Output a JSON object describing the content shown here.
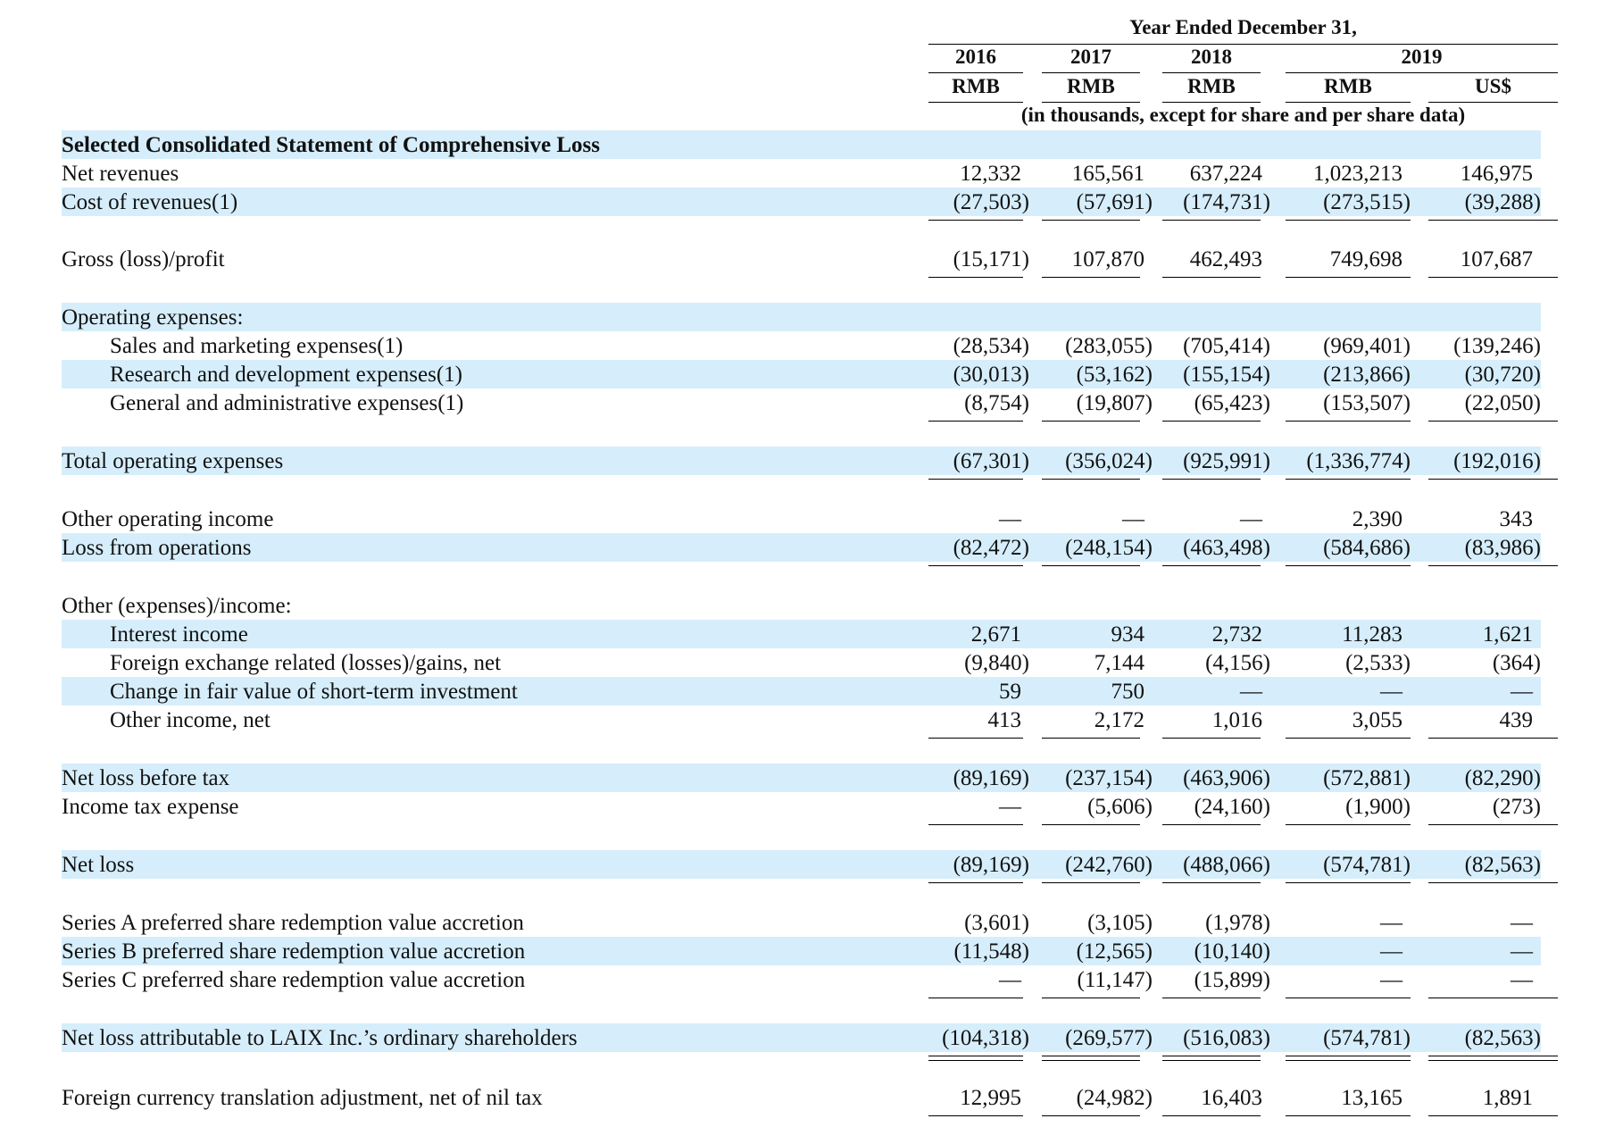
{
  "header": {
    "caption": "Year Ended December 31,",
    "years": [
      "2016",
      "2017",
      "2018",
      "2019"
    ],
    "currencies": [
      "RMB",
      "RMB",
      "RMB",
      "RMB",
      "US$"
    ],
    "note": "(in thousands, except for share and per share data)"
  },
  "colors": {
    "band": "#d6eefb",
    "text": "#111111"
  },
  "rows": [
    {
      "label": "Selected Consolidated Statement of Comprehensive Loss",
      "bold": true,
      "band": true,
      "values": []
    },
    {
      "label": "Net revenues",
      "values": [
        "12,332",
        "165,561",
        "637,224",
        "1,023,213",
        "146,975"
      ]
    },
    {
      "label": "Cost of revenues(1)",
      "band": true,
      "values": [
        "(27,503)",
        "(57,691)",
        "(174,731)",
        "(273,515)",
        "(39,288)"
      ],
      "underline": "single"
    },
    {
      "label": "Gross (loss)/profit",
      "values": [
        "(15,171)",
        "107,870",
        "462,493",
        "749,698",
        "107,687"
      ],
      "underline": "single"
    },
    {
      "label": "Operating expenses:",
      "band": true,
      "values": []
    },
    {
      "label": "Sales and marketing expenses(1)",
      "indent": true,
      "values": [
        "(28,534)",
        "(283,055)",
        "(705,414)",
        "(969,401)",
        "(139,246)"
      ]
    },
    {
      "label": "Research and development expenses(1)",
      "indent": true,
      "band": true,
      "values": [
        "(30,013)",
        "(53,162)",
        "(155,154)",
        "(213,866)",
        "(30,720)"
      ]
    },
    {
      "label": "General and administrative expenses(1)",
      "indent": true,
      "values": [
        "(8,754)",
        "(19,807)",
        "(65,423)",
        "(153,507)",
        "(22,050)"
      ],
      "underline": "single"
    },
    {
      "label": "Total operating expenses",
      "band": true,
      "values": [
        "(67,301)",
        "(356,024)",
        "(925,991)",
        "(1,336,774)",
        "(192,016)"
      ],
      "underline": "single"
    },
    {
      "label": "Other operating income",
      "values": [
        "—",
        "—",
        "—",
        "2,390",
        "343"
      ]
    },
    {
      "label": "Loss from operations",
      "band": true,
      "values": [
        "(82,472)",
        "(248,154)",
        "(463,498)",
        "(584,686)",
        "(83,986)"
      ],
      "underline": "single"
    },
    {
      "label": "Other (expenses)/income:",
      "values": []
    },
    {
      "label": "Interest income",
      "indent": true,
      "band": true,
      "values": [
        "2,671",
        "934",
        "2,732",
        "11,283",
        "1,621"
      ]
    },
    {
      "label": "Foreign exchange related (losses)/gains, net",
      "indent": true,
      "values": [
        "(9,840)",
        "7,144",
        "(4,156)",
        "(2,533)",
        "(364)"
      ]
    },
    {
      "label": "Change in fair value of short-term investment",
      "indent": true,
      "band": true,
      "values": [
        "59",
        "750",
        "—",
        "—",
        "—"
      ]
    },
    {
      "label": "Other income, net",
      "indent": true,
      "values": [
        "413",
        "2,172",
        "1,016",
        "3,055",
        "439"
      ],
      "underline": "single"
    },
    {
      "label": "Net loss before tax",
      "band": true,
      "values": [
        "(89,169)",
        "(237,154)",
        "(463,906)",
        "(572,881)",
        "(82,290)"
      ]
    },
    {
      "label": "Income tax expense",
      "values": [
        "—",
        "(5,606)",
        "(24,160)",
        "(1,900)",
        "(273)"
      ],
      "underline": "single"
    },
    {
      "label": "Net loss",
      "band": true,
      "values": [
        "(89,169)",
        "(242,760)",
        "(488,066)",
        "(574,781)",
        "(82,563)"
      ],
      "underline": "single"
    },
    {
      "label": "Series A preferred share redemption value accretion",
      "values": [
        "(3,601)",
        "(3,105)",
        "(1,978)",
        "—",
        "—"
      ]
    },
    {
      "label": "Series B preferred share redemption value accretion",
      "band": true,
      "values": [
        "(11,548)",
        "(12,565)",
        "(10,140)",
        "—",
        "—"
      ]
    },
    {
      "label": "Series C preferred share redemption value accretion",
      "values": [
        "—",
        "(11,147)",
        "(15,899)",
        "—",
        "—"
      ],
      "underline": "single"
    },
    {
      "label": "Net loss attributable to LAIX Inc.’s ordinary shareholders",
      "band": true,
      "values": [
        "(104,318)",
        "(269,577)",
        "(516,083)",
        "(574,781)",
        "(82,563)"
      ],
      "underline": "double"
    },
    {
      "label": "Foreign currency translation adjustment, net of nil tax",
      "values": [
        "12,995",
        "(24,982)",
        "16,403",
        "13,165",
        "1,891"
      ],
      "underline": "single"
    }
  ]
}
